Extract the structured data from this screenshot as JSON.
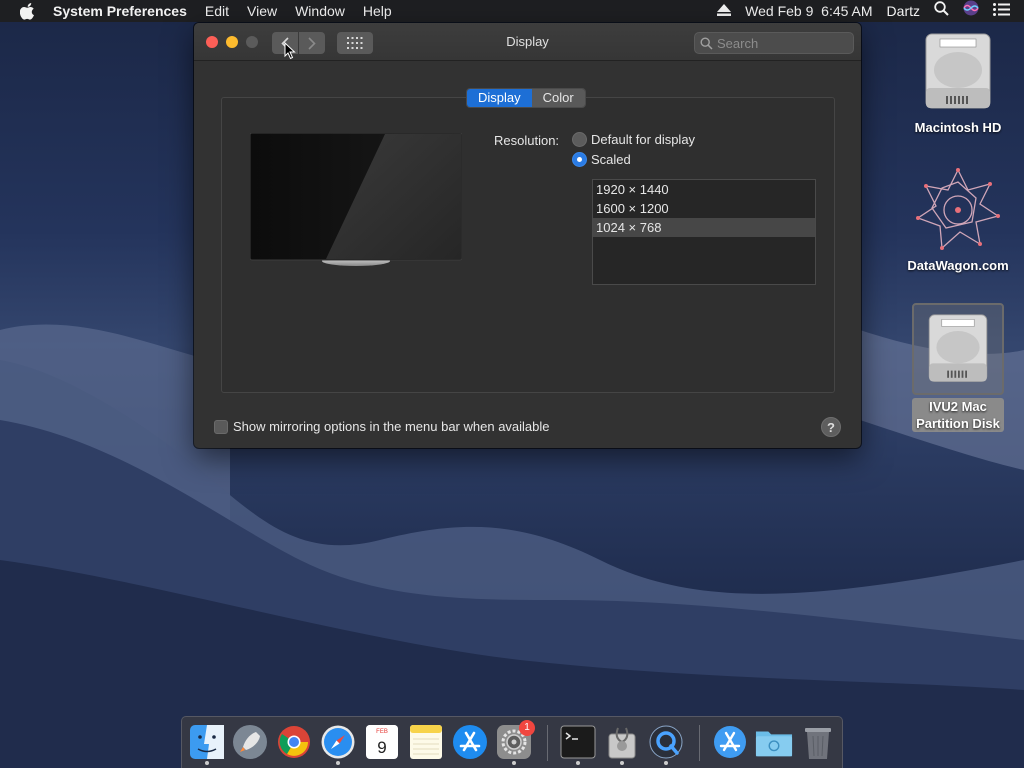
{
  "menubar": {
    "app_name": "System Preferences",
    "menus": [
      "Edit",
      "View",
      "Window",
      "Help"
    ],
    "datetime": "Wed Feb 9  6:45 AM",
    "user": "Dartz"
  },
  "window": {
    "title": "Display",
    "search_placeholder": "Search",
    "tabs": [
      {
        "label": "Display",
        "selected": true
      },
      {
        "label": "Color",
        "selected": false
      }
    ],
    "resolution_label": "Resolution:",
    "resolution_options": [
      {
        "label": "Default for display",
        "selected": false
      },
      {
        "label": "Scaled",
        "selected": true
      }
    ],
    "scaled_resolutions": [
      {
        "label": "1920 × 1440",
        "selected": false
      },
      {
        "label": "1600 × 1200",
        "selected": false
      },
      {
        "label": "1024 × 768",
        "selected": true
      }
    ],
    "mirroring_checkbox_label": "Show mirroring options in the menu bar when available",
    "mirroring_checked": false,
    "help_label": "?"
  },
  "desktop_icons": [
    {
      "label": "Macintosh HD",
      "icon": "hard-drive-icon"
    },
    {
      "label": "DataWagon.com",
      "icon": "datawagon-logo-icon"
    },
    {
      "label_line1": "IVU2 Mac",
      "label_line2": "Partition Disk",
      "icon": "hard-drive-icon",
      "selected": true
    }
  ],
  "dock": {
    "calendar_month": "FEB",
    "calendar_day": "9",
    "system_prefs_badge": "1",
    "apps": [
      "finder",
      "launchpad",
      "chrome",
      "safari",
      "calendar",
      "notes",
      "app-store",
      "system-preferences",
      "terminal",
      "disk-utility",
      "quicktime",
      "app-store-downloads",
      "downloads-folder",
      "trash"
    ]
  },
  "colors": {
    "accent_blue": "#1d6fd6",
    "close_red": "#fc5f57",
    "minimize_yellow": "#fdbb2e"
  }
}
